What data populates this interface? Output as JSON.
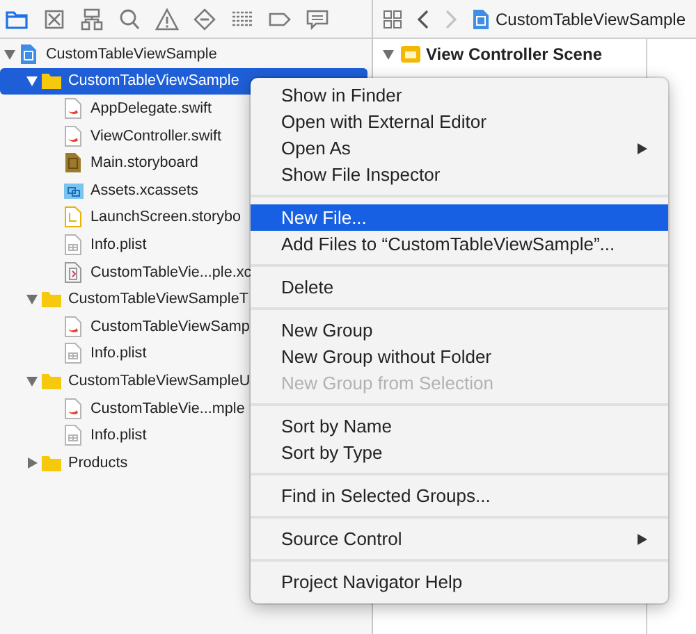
{
  "navigator_tabs": [
    {
      "kind": "folder",
      "selected": true
    },
    {
      "kind": "crossed-square",
      "selected": false
    },
    {
      "kind": "hierarchy",
      "selected": false
    },
    {
      "kind": "search",
      "selected": false
    },
    {
      "kind": "warning",
      "selected": false
    },
    {
      "kind": "diamond",
      "selected": false
    },
    {
      "kind": "list",
      "selected": false
    },
    {
      "kind": "tag",
      "selected": false
    },
    {
      "kind": "speech-bubble",
      "selected": false
    }
  ],
  "tree": [
    {
      "label": "CustomTableViewSample",
      "kind": "project",
      "expanded": true,
      "selected": false,
      "children": [
        {
          "label": "CustomTableViewSample",
          "kind": "folder",
          "expanded": true,
          "selected": true,
          "children": [
            {
              "label": "AppDelegate.swift",
              "kind": "swift",
              "selected": false
            },
            {
              "label": "ViewController.swift",
              "kind": "swift",
              "selected": false
            },
            {
              "label": "Main.storyboard",
              "kind": "storyboard",
              "selected": false
            },
            {
              "label": "Assets.xcassets",
              "kind": "assets",
              "selected": false
            },
            {
              "label": "LaunchScreen.storybo",
              "kind": "launch",
              "selected": false
            },
            {
              "label": "Info.plist",
              "kind": "plist",
              "selected": false
            },
            {
              "label": "CustomTableVie...ple.xc",
              "kind": "xcodeproj",
              "selected": false
            }
          ]
        },
        {
          "label": "CustomTableViewSampleT",
          "kind": "folder",
          "expanded": true,
          "selected": false,
          "children": [
            {
              "label": "CustomTableViewSamp",
              "kind": "swift",
              "selected": false
            },
            {
              "label": "Info.plist",
              "kind": "plist",
              "selected": false
            }
          ]
        },
        {
          "label": "CustomTableViewSampleU",
          "kind": "folder",
          "expanded": true,
          "selected": false,
          "children": [
            {
              "label": "CustomTableVie...mple",
              "kind": "swift",
              "selected": false
            },
            {
              "label": "Info.plist",
              "kind": "plist",
              "selected": false
            }
          ]
        },
        {
          "label": "Products",
          "kind": "folder",
          "expanded": false,
          "selected": false
        }
      ]
    }
  ],
  "editor": {
    "back": {
      "disabled": false
    },
    "forward": {
      "disabled": true
    },
    "breadcrumb": "CustomTableViewSample",
    "outline": [
      {
        "label": "View Controller Scene",
        "expanded": true
      }
    ]
  },
  "context_menu": [
    {
      "kind": "item",
      "label": "Show in Finder",
      "selected": false,
      "disabled": false,
      "submenu": false
    },
    {
      "kind": "item",
      "label": "Open with External Editor",
      "selected": false,
      "disabled": false,
      "submenu": false
    },
    {
      "kind": "item",
      "label": "Open As",
      "selected": false,
      "disabled": false,
      "submenu": true
    },
    {
      "kind": "item",
      "label": "Show File Inspector",
      "selected": false,
      "disabled": false,
      "submenu": false
    },
    {
      "kind": "separator"
    },
    {
      "kind": "item",
      "label": "New File...",
      "selected": true,
      "disabled": false,
      "submenu": false
    },
    {
      "kind": "item",
      "label": "Add Files to “CustomTableViewSample”...",
      "selected": false,
      "disabled": false,
      "submenu": false
    },
    {
      "kind": "separator"
    },
    {
      "kind": "item",
      "label": "Delete",
      "selected": false,
      "disabled": false,
      "submenu": false
    },
    {
      "kind": "separator"
    },
    {
      "kind": "item",
      "label": "New Group",
      "selected": false,
      "disabled": false,
      "submenu": false
    },
    {
      "kind": "item",
      "label": "New Group without Folder",
      "selected": false,
      "disabled": false,
      "submenu": false
    },
    {
      "kind": "item",
      "label": "New Group from Selection",
      "selected": false,
      "disabled": true,
      "submenu": false
    },
    {
      "kind": "separator"
    },
    {
      "kind": "item",
      "label": "Sort by Name",
      "selected": false,
      "disabled": false,
      "submenu": false
    },
    {
      "kind": "item",
      "label": "Sort by Type",
      "selected": false,
      "disabled": false,
      "submenu": false
    },
    {
      "kind": "separator"
    },
    {
      "kind": "item",
      "label": "Find in Selected Groups...",
      "selected": false,
      "disabled": false,
      "submenu": false
    },
    {
      "kind": "separator"
    },
    {
      "kind": "item",
      "label": "Source Control",
      "selected": false,
      "disabled": false,
      "submenu": true
    },
    {
      "kind": "separator"
    },
    {
      "kind": "item",
      "label": "Project Navigator Help",
      "selected": false,
      "disabled": false,
      "submenu": false
    }
  ]
}
